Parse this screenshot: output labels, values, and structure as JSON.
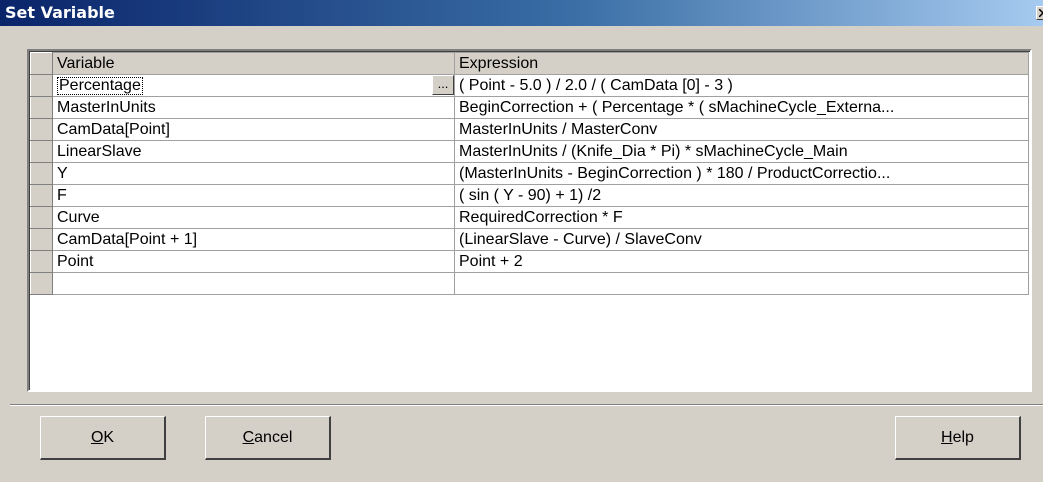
{
  "window": {
    "title": "Set Variable"
  },
  "grid": {
    "headers": {
      "variable": "Variable",
      "expression": "Expression"
    },
    "rows": [
      {
        "variable": "Percentage",
        "expression": "( Point - 5.0 ) / 2.0 / ( CamData [0] - 3 )"
      },
      {
        "variable": "MasterInUnits",
        "expression": "BeginCorrection  + ( Percentage * ( sMachineCycle_Externa..."
      },
      {
        "variable": "CamData[Point]",
        "expression": "MasterInUnits / MasterConv"
      },
      {
        "variable": "LinearSlave",
        "expression": "MasterInUnits / (Knife_Dia * Pi) * sMachineCycle_Main"
      },
      {
        "variable": "Y",
        "expression": "(MasterInUnits - BeginCorrection ) * 180 / ProductCorrectio..."
      },
      {
        "variable": "F",
        "expression": "( sin ( Y - 90) + 1) /2"
      },
      {
        "variable": "Curve",
        "expression": "RequiredCorrection * F"
      },
      {
        "variable": "CamData[Point + 1]",
        "expression": "(LinearSlave - Curve) / SlaveConv"
      },
      {
        "variable": "Point",
        "expression": "Point + 2"
      },
      {
        "variable": "",
        "expression": ""
      }
    ],
    "ellipsis_label": "..."
  },
  "buttons": {
    "ok": {
      "mnemonic": "O",
      "rest": "K"
    },
    "cancel": {
      "mnemonic": "C",
      "rest": "ancel"
    },
    "help": {
      "mnemonic": "H",
      "rest": "elp"
    }
  }
}
